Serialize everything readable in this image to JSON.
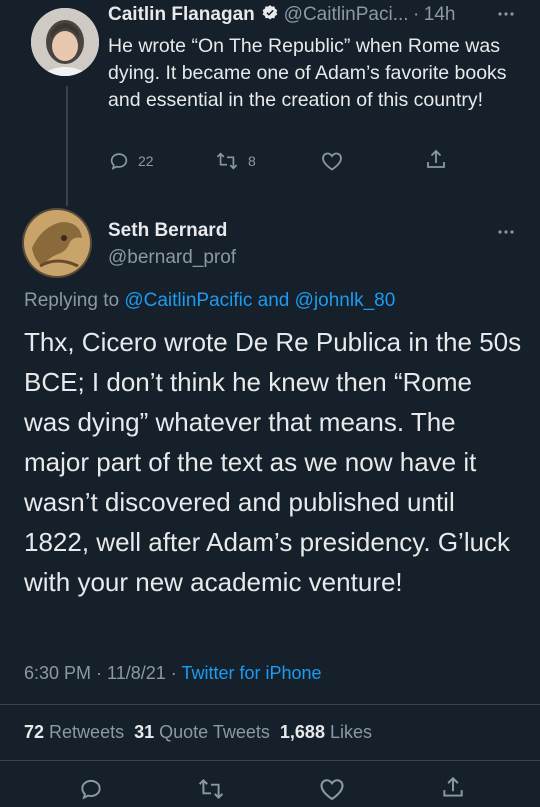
{
  "parent_tweet": {
    "name": "Caitlin Flanagan",
    "handle": "@CaitlinPaci...",
    "sep": "·",
    "time": "14h",
    "text": "He wrote “On The Republic” when Rome was dying. It became one of Adam’s favorite books and essential in the creation of this country!",
    "replies": "22",
    "retweets": "8"
  },
  "main_tweet": {
    "name": "Seth Bernard",
    "handle": "@bernard_prof",
    "replying_to_prefix": "Replying to",
    "reply_user_1": "@CaitlinPacific",
    "reply_and": "and",
    "reply_user_2": "@johnlk_80",
    "text": "Thx, Cicero wrote De Re Publica in the 50s BCE; I don’t think he knew then “Rome was dying” whatever that means. The major part of the text as we now have it wasn’t discovered and published until 1822, well after Adam’s presidency. G’luck with your new academic venture!",
    "timestamp": "6:30 PM · 11/8/21 ·",
    "source": "Twitter for iPhone",
    "retweet_count": "72",
    "retweet_label": "Retweets",
    "quote_count": "31",
    "quote_label": "Quote Tweets",
    "like_count": "1,688",
    "like_label": "Likes"
  },
  "colors": {
    "background": "#15202b",
    "text": "#e7e9ea",
    "muted": "#8b98a5",
    "link": "#1d9bf0",
    "verified": "#e7e9ea"
  },
  "icons": [
    "verified-badge-icon",
    "more-icon",
    "reply-icon",
    "retweet-icon",
    "like-icon",
    "share-icon"
  ]
}
